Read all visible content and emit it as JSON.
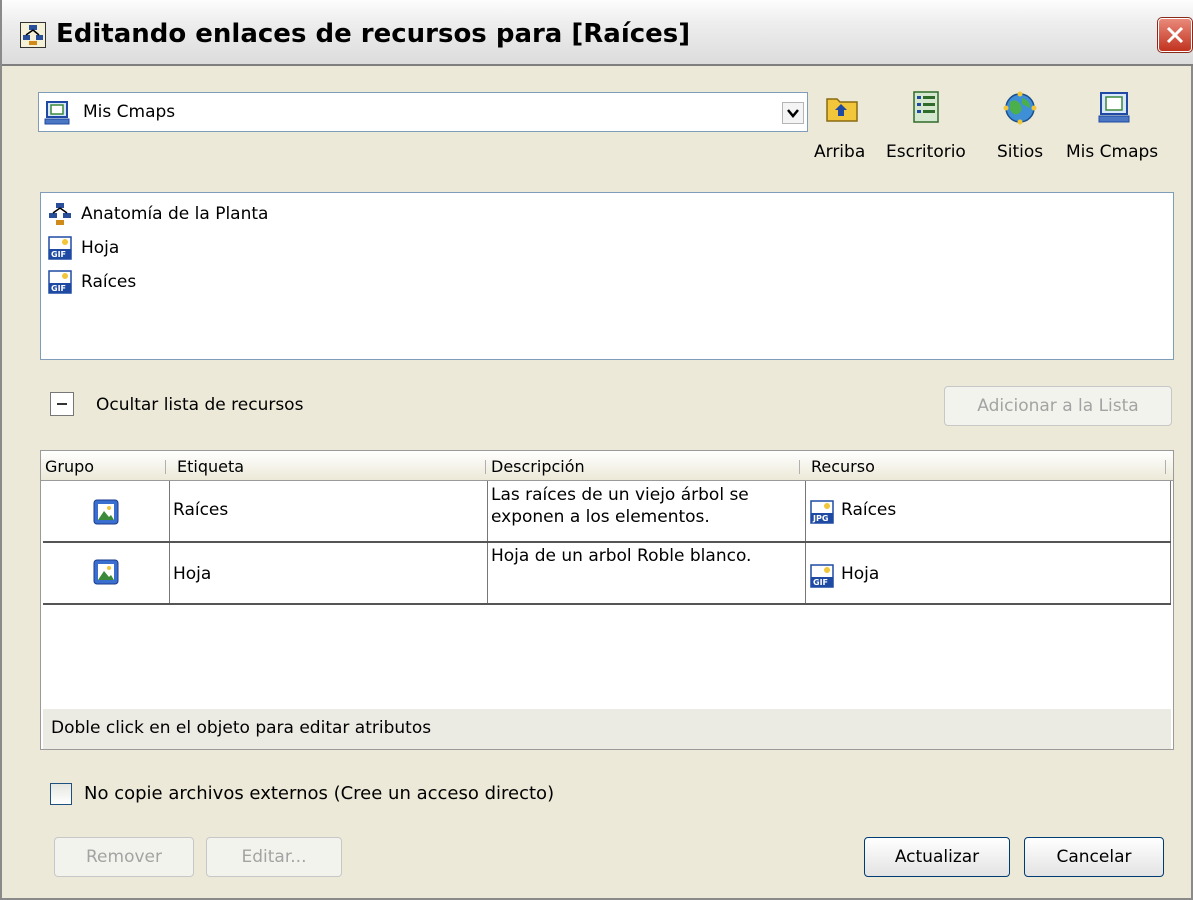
{
  "window": {
    "title": "Editando enlaces de recursos para [Raíces]"
  },
  "location": {
    "selected": "Mis Cmaps",
    "icon": "computer-icon"
  },
  "toolbar": [
    {
      "label": "Arriba",
      "icon": "folder-up-icon"
    },
    {
      "label": "Escritorio",
      "icon": "desktop-icon"
    },
    {
      "label": "Sitios",
      "icon": "sites-globe-icon"
    },
    {
      "label": "Mis Cmaps",
      "icon": "computer-icon"
    }
  ],
  "resources": [
    {
      "label": "Anatomía de la Planta",
      "icon": "cmap-icon"
    },
    {
      "label": "Hoja",
      "icon": "gif-file-icon"
    },
    {
      "label": "Raíces",
      "icon": "gif-file-icon"
    }
  ],
  "hide_list_label": "Ocultar lista de recursos",
  "add_button": "Adicionar a la Lista",
  "table": {
    "columns": [
      "Grupo",
      "Etiqueta",
      "Descripción",
      "Recurso"
    ],
    "rows": [
      {
        "group_icon": "image-group-icon",
        "label": "Raíces",
        "description": "Las raíces de un viejo árbol se exponen a los elementos.",
        "resource": "Raíces",
        "resource_icon": "jpg-file-icon"
      },
      {
        "group_icon": "image-group-icon",
        "label": "Hoja",
        "description": "Hoja de un arbol Roble blanco.",
        "resource": "Hoja",
        "resource_icon": "gif-file-icon"
      }
    ],
    "status": "Doble click en el objeto para editar atributos"
  },
  "no_copy_label": "No copie archivos externos (Cree un acceso directo)",
  "no_copy_checked": false,
  "buttons": {
    "remove": "Remover",
    "edit": "Editar...",
    "update": "Actualizar",
    "cancel": "Cancelar"
  }
}
